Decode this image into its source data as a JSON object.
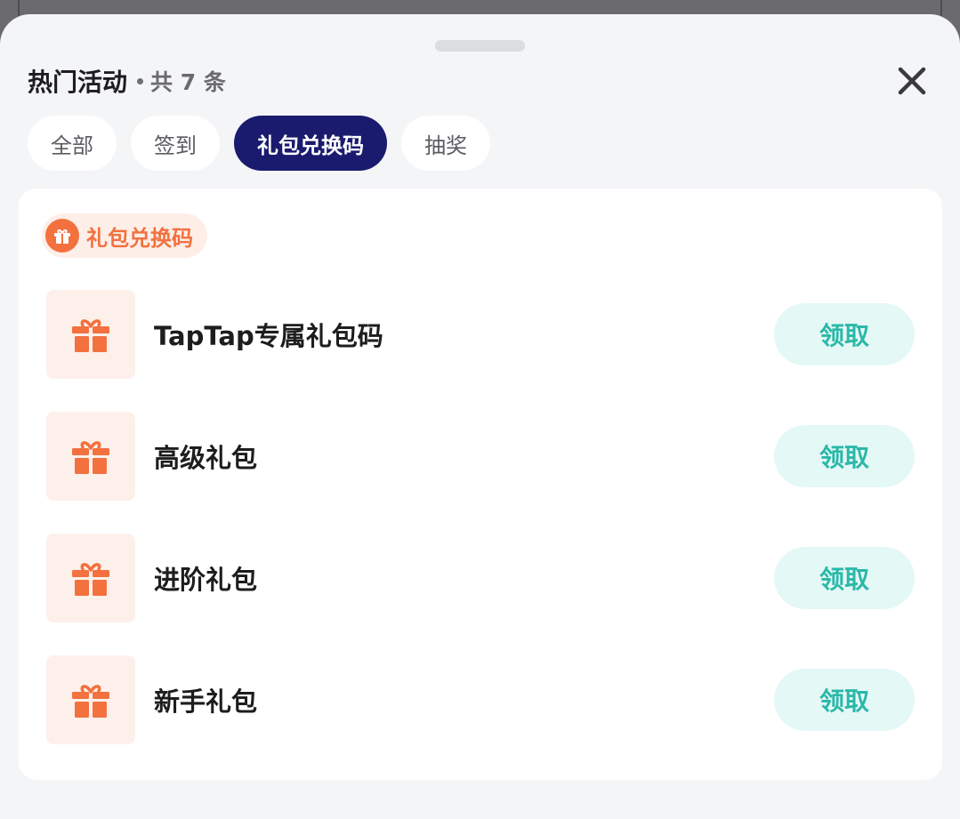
{
  "sheet": {
    "title": "热门活动",
    "count_text": "共 7 条"
  },
  "tabs": [
    {
      "label": "全部",
      "active": false
    },
    {
      "label": "签到",
      "active": false
    },
    {
      "label": "礼包兑换码",
      "active": true
    },
    {
      "label": "抽奖",
      "active": false
    }
  ],
  "section": {
    "label": "礼包兑换码",
    "icon": "gift-icon"
  },
  "gifts": [
    {
      "name": "TapTap专属礼包码",
      "action": "领取",
      "icon": "gift-icon"
    },
    {
      "name": "高级礼包",
      "action": "领取",
      "icon": "gift-icon"
    },
    {
      "name": "进阶礼包",
      "action": "领取",
      "icon": "gift-icon"
    },
    {
      "name": "新手礼包",
      "action": "领取",
      "icon": "gift-icon"
    }
  ],
  "colors": {
    "accent_tab": "#1a1b6e",
    "gift_orange": "#f2713f",
    "claim_text": "#2bb8a8",
    "claim_bg": "#e4f8f6"
  }
}
